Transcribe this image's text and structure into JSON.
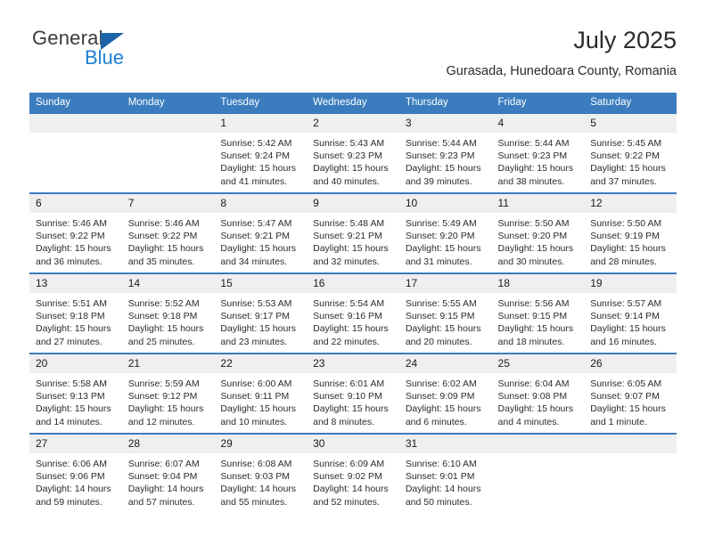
{
  "brand": {
    "word_one": "General",
    "word_two": "Blue",
    "flag_icon": "triangle-flag-icon",
    "colors": {
      "general": "#3c3c3c",
      "blue": "#1e7fd4",
      "flag": "#1d63a8"
    }
  },
  "header": {
    "title": "July 2025",
    "subtitle": "Gurasada, Hunedoara County, Romania"
  },
  "theme": {
    "header_bar": "#3a7cbe",
    "daynum_band": "#efefef",
    "row_border": "#3a7cbe",
    "text": "#2b2b2b"
  },
  "calendar": {
    "weekdays": [
      "Sunday",
      "Monday",
      "Tuesday",
      "Wednesday",
      "Thursday",
      "Friday",
      "Saturday"
    ],
    "weeks": [
      [
        {
          "day": "",
          "sunrise": "",
          "sunset": "",
          "daylight_line1": "",
          "daylight_line2": ""
        },
        {
          "day": "",
          "sunrise": "",
          "sunset": "",
          "daylight_line1": "",
          "daylight_line2": ""
        },
        {
          "day": "1",
          "sunrise": "Sunrise: 5:42 AM",
          "sunset": "Sunset: 9:24 PM",
          "daylight_line1": "Daylight: 15 hours",
          "daylight_line2": "and 41 minutes."
        },
        {
          "day": "2",
          "sunrise": "Sunrise: 5:43 AM",
          "sunset": "Sunset: 9:23 PM",
          "daylight_line1": "Daylight: 15 hours",
          "daylight_line2": "and 40 minutes."
        },
        {
          "day": "3",
          "sunrise": "Sunrise: 5:44 AM",
          "sunset": "Sunset: 9:23 PM",
          "daylight_line1": "Daylight: 15 hours",
          "daylight_line2": "and 39 minutes."
        },
        {
          "day": "4",
          "sunrise": "Sunrise: 5:44 AM",
          "sunset": "Sunset: 9:23 PM",
          "daylight_line1": "Daylight: 15 hours",
          "daylight_line2": "and 38 minutes."
        },
        {
          "day": "5",
          "sunrise": "Sunrise: 5:45 AM",
          "sunset": "Sunset: 9:22 PM",
          "daylight_line1": "Daylight: 15 hours",
          "daylight_line2": "and 37 minutes."
        }
      ],
      [
        {
          "day": "6",
          "sunrise": "Sunrise: 5:46 AM",
          "sunset": "Sunset: 9:22 PM",
          "daylight_line1": "Daylight: 15 hours",
          "daylight_line2": "and 36 minutes."
        },
        {
          "day": "7",
          "sunrise": "Sunrise: 5:46 AM",
          "sunset": "Sunset: 9:22 PM",
          "daylight_line1": "Daylight: 15 hours",
          "daylight_line2": "and 35 minutes."
        },
        {
          "day": "8",
          "sunrise": "Sunrise: 5:47 AM",
          "sunset": "Sunset: 9:21 PM",
          "daylight_line1": "Daylight: 15 hours",
          "daylight_line2": "and 34 minutes."
        },
        {
          "day": "9",
          "sunrise": "Sunrise: 5:48 AM",
          "sunset": "Sunset: 9:21 PM",
          "daylight_line1": "Daylight: 15 hours",
          "daylight_line2": "and 32 minutes."
        },
        {
          "day": "10",
          "sunrise": "Sunrise: 5:49 AM",
          "sunset": "Sunset: 9:20 PM",
          "daylight_line1": "Daylight: 15 hours",
          "daylight_line2": "and 31 minutes."
        },
        {
          "day": "11",
          "sunrise": "Sunrise: 5:50 AM",
          "sunset": "Sunset: 9:20 PM",
          "daylight_line1": "Daylight: 15 hours",
          "daylight_line2": "and 30 minutes."
        },
        {
          "day": "12",
          "sunrise": "Sunrise: 5:50 AM",
          "sunset": "Sunset: 9:19 PM",
          "daylight_line1": "Daylight: 15 hours",
          "daylight_line2": "and 28 minutes."
        }
      ],
      [
        {
          "day": "13",
          "sunrise": "Sunrise: 5:51 AM",
          "sunset": "Sunset: 9:18 PM",
          "daylight_line1": "Daylight: 15 hours",
          "daylight_line2": "and 27 minutes."
        },
        {
          "day": "14",
          "sunrise": "Sunrise: 5:52 AM",
          "sunset": "Sunset: 9:18 PM",
          "daylight_line1": "Daylight: 15 hours",
          "daylight_line2": "and 25 minutes."
        },
        {
          "day": "15",
          "sunrise": "Sunrise: 5:53 AM",
          "sunset": "Sunset: 9:17 PM",
          "daylight_line1": "Daylight: 15 hours",
          "daylight_line2": "and 23 minutes."
        },
        {
          "day": "16",
          "sunrise": "Sunrise: 5:54 AM",
          "sunset": "Sunset: 9:16 PM",
          "daylight_line1": "Daylight: 15 hours",
          "daylight_line2": "and 22 minutes."
        },
        {
          "day": "17",
          "sunrise": "Sunrise: 5:55 AM",
          "sunset": "Sunset: 9:15 PM",
          "daylight_line1": "Daylight: 15 hours",
          "daylight_line2": "and 20 minutes."
        },
        {
          "day": "18",
          "sunrise": "Sunrise: 5:56 AM",
          "sunset": "Sunset: 9:15 PM",
          "daylight_line1": "Daylight: 15 hours",
          "daylight_line2": "and 18 minutes."
        },
        {
          "day": "19",
          "sunrise": "Sunrise: 5:57 AM",
          "sunset": "Sunset: 9:14 PM",
          "daylight_line1": "Daylight: 15 hours",
          "daylight_line2": "and 16 minutes."
        }
      ],
      [
        {
          "day": "20",
          "sunrise": "Sunrise: 5:58 AM",
          "sunset": "Sunset: 9:13 PM",
          "daylight_line1": "Daylight: 15 hours",
          "daylight_line2": "and 14 minutes."
        },
        {
          "day": "21",
          "sunrise": "Sunrise: 5:59 AM",
          "sunset": "Sunset: 9:12 PM",
          "daylight_line1": "Daylight: 15 hours",
          "daylight_line2": "and 12 minutes."
        },
        {
          "day": "22",
          "sunrise": "Sunrise: 6:00 AM",
          "sunset": "Sunset: 9:11 PM",
          "daylight_line1": "Daylight: 15 hours",
          "daylight_line2": "and 10 minutes."
        },
        {
          "day": "23",
          "sunrise": "Sunrise: 6:01 AM",
          "sunset": "Sunset: 9:10 PM",
          "daylight_line1": "Daylight: 15 hours",
          "daylight_line2": "and 8 minutes."
        },
        {
          "day": "24",
          "sunrise": "Sunrise: 6:02 AM",
          "sunset": "Sunset: 9:09 PM",
          "daylight_line1": "Daylight: 15 hours",
          "daylight_line2": "and 6 minutes."
        },
        {
          "day": "25",
          "sunrise": "Sunrise: 6:04 AM",
          "sunset": "Sunset: 9:08 PM",
          "daylight_line1": "Daylight: 15 hours",
          "daylight_line2": "and 4 minutes."
        },
        {
          "day": "26",
          "sunrise": "Sunrise: 6:05 AM",
          "sunset": "Sunset: 9:07 PM",
          "daylight_line1": "Daylight: 15 hours",
          "daylight_line2": "and 1 minute."
        }
      ],
      [
        {
          "day": "27",
          "sunrise": "Sunrise: 6:06 AM",
          "sunset": "Sunset: 9:06 PM",
          "daylight_line1": "Daylight: 14 hours",
          "daylight_line2": "and 59 minutes."
        },
        {
          "day": "28",
          "sunrise": "Sunrise: 6:07 AM",
          "sunset": "Sunset: 9:04 PM",
          "daylight_line1": "Daylight: 14 hours",
          "daylight_line2": "and 57 minutes."
        },
        {
          "day": "29",
          "sunrise": "Sunrise: 6:08 AM",
          "sunset": "Sunset: 9:03 PM",
          "daylight_line1": "Daylight: 14 hours",
          "daylight_line2": "and 55 minutes."
        },
        {
          "day": "30",
          "sunrise": "Sunrise: 6:09 AM",
          "sunset": "Sunset: 9:02 PM",
          "daylight_line1": "Daylight: 14 hours",
          "daylight_line2": "and 52 minutes."
        },
        {
          "day": "31",
          "sunrise": "Sunrise: 6:10 AM",
          "sunset": "Sunset: 9:01 PM",
          "daylight_line1": "Daylight: 14 hours",
          "daylight_line2": "and 50 minutes."
        },
        {
          "day": "",
          "sunrise": "",
          "sunset": "",
          "daylight_line1": "",
          "daylight_line2": ""
        },
        {
          "day": "",
          "sunrise": "",
          "sunset": "",
          "daylight_line1": "",
          "daylight_line2": ""
        }
      ]
    ]
  }
}
